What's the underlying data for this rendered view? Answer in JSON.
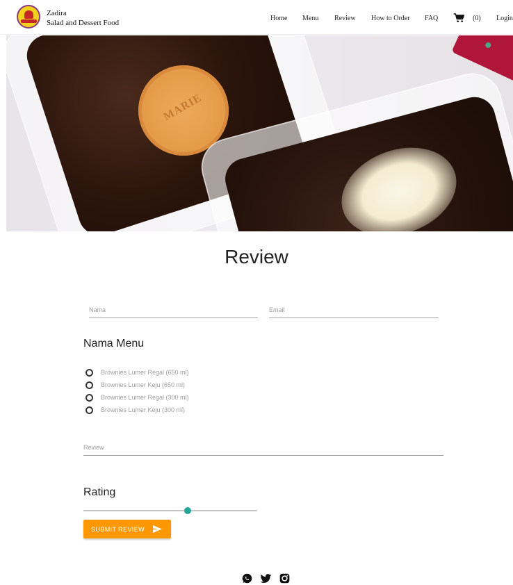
{
  "header": {
    "brand_name": "Zadira",
    "brand_tagline": "Salad and Dessert Food",
    "nav": [
      "Home",
      "Menu",
      "Review",
      "How to Order",
      "FAQ"
    ],
    "cart_count": "(0)",
    "login": "Login"
  },
  "hero": {
    "biscuit_text": "MARIE"
  },
  "review": {
    "title": "Review",
    "name_placeholder": "Nama",
    "email_placeholder": "Email",
    "menu_label": "Nama Menu",
    "menu_options": [
      "Brownies Lumer Regal (650 ml)",
      "Brownies Lumer Keju (650 ml)",
      "Brownies Lumer Regal (300 ml)",
      "Brownies Lumer Keju (300 ml)"
    ],
    "review_placeholder": "Review",
    "rating_label": "Rating",
    "rating_fraction": 0.6,
    "submit_label": "SUBMIT REVIEW"
  },
  "colors": {
    "accent": "#ff9800",
    "slider": "#26a69a"
  },
  "footer": {
    "icons": [
      "whatsapp-icon",
      "twitter-icon",
      "instagram-icon"
    ]
  }
}
